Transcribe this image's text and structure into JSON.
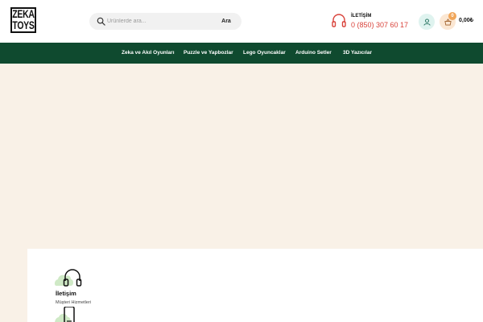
{
  "logo": {
    "line1": "ZEKA",
    "line2": "TOYS"
  },
  "search": {
    "placeholder": "Ürünlerde ara...",
    "button_label": "Ara"
  },
  "contact": {
    "title": "İLETİŞİM",
    "phone": "0 (850) 307 60 17"
  },
  "cart": {
    "count": "0",
    "total": "0,00₺"
  },
  "nav": {
    "items": [
      {
        "label": "Zeka ve Akıl Oyunları"
      },
      {
        "label": "Puzzle ve Yapbozlar"
      },
      {
        "label": "Lego Oyuncaklar"
      },
      {
        "label": "Arduino Setler"
      },
      {
        "label": "3D Yazıcılar"
      }
    ]
  },
  "features": [
    {
      "title": "İletişim",
      "subtitle": "Müşteri Hizmetleri",
      "icon": "headset-icon"
    },
    {
      "icon": "phone-icon"
    }
  ],
  "colors": {
    "nav_bg": "#0f4a2f",
    "hero_bg": "#f9f1e7",
    "phone_red": "#d9433b",
    "user_bg": "#dff3ef",
    "cart_bg": "#fbe7d3",
    "badge": "#f0a65a"
  }
}
